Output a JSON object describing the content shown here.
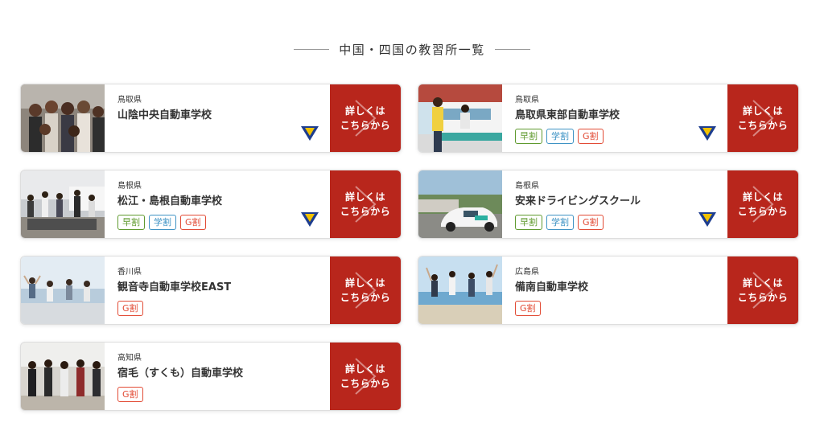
{
  "section": {
    "title": "中国・四国の教習所一覧"
  },
  "colors": {
    "button_red": "#b8261c",
    "badge_hayawari": "#5f9a2e",
    "badge_gakuwari": "#3e93c4",
    "badge_gwari": "#e24b35",
    "tpoint_blue": "#1d3d8f",
    "tpoint_yellow": "#f2c200"
  },
  "schools": [
    {
      "prefecture": "鳥取県",
      "name": "山陰中央自動車学校",
      "badges": [],
      "tpoint": true,
      "button": {
        "line1": "詳しくは",
        "line2": "こちらから"
      }
    },
    {
      "prefecture": "鳥取県",
      "name": "鳥取県東部自動車学校",
      "badges": [
        "早割",
        "学割",
        "G割"
      ],
      "tpoint": true,
      "button": {
        "line1": "詳しくは",
        "line2": "こちらから"
      }
    },
    {
      "prefecture": "島根県",
      "name": "松江・島根自動車学校",
      "badges": [
        "早割",
        "学割",
        "G割"
      ],
      "tpoint": true,
      "button": {
        "line1": "詳しくは",
        "line2": "こちらから"
      }
    },
    {
      "prefecture": "島根県",
      "name": "安来ドライビングスクール",
      "badges": [
        "早割",
        "学割",
        "G割"
      ],
      "tpoint": true,
      "button": {
        "line1": "詳しくは",
        "line2": "こちらから"
      }
    },
    {
      "prefecture": "香川県",
      "name": "観音寺自動車学校EAST",
      "badges": [
        "G割"
      ],
      "tpoint": false,
      "button": {
        "line1": "詳しくは",
        "line2": "こちらから"
      }
    },
    {
      "prefecture": "広島県",
      "name": "備南自動車学校",
      "badges": [
        "G割"
      ],
      "tpoint": false,
      "button": {
        "line1": "詳しくは",
        "line2": "こちらから"
      }
    },
    {
      "prefecture": "高知県",
      "name": "宿毛（すくも）自動車学校",
      "badges": [
        "G割"
      ],
      "tpoint": false,
      "button": {
        "line1": "詳しくは",
        "line2": "こちらから"
      }
    }
  ]
}
